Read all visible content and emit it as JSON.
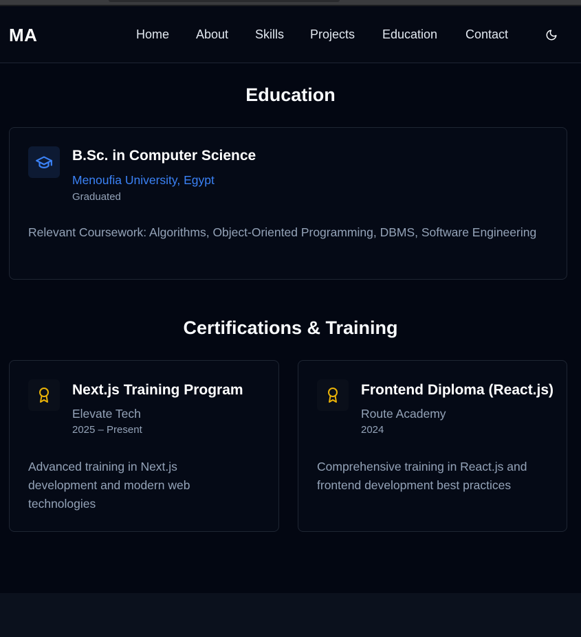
{
  "nav": {
    "logo": "MA",
    "links": [
      "Home",
      "About",
      "Skills",
      "Projects",
      "Education",
      "Contact"
    ],
    "theme_icon": "moon-icon"
  },
  "education": {
    "title": "Education",
    "card": {
      "icon": "graduation-cap-icon",
      "degree": "B.Sc. in Computer Science",
      "university": "Menoufia University, Egypt",
      "status": "Graduated",
      "coursework": "Relevant Coursework: Algorithms, Object-Oriented Programming, DBMS, Software Engineering"
    }
  },
  "certifications": {
    "title": "Certifications & Training",
    "items": [
      {
        "icon": "award-icon",
        "title": "Next.js Training Program",
        "org": "Elevate Tech",
        "date": "2025 – Present",
        "desc": "Advanced training in Next.js development and modern web technologies"
      },
      {
        "icon": "award-icon",
        "title": "Frontend Diploma (React.js)",
        "org": "Route Academy",
        "date": "2024",
        "desc": "Comprehensive training in React.js and frontend development best practices"
      }
    ]
  },
  "colors": {
    "background": "#030712",
    "accent_blue": "#3b82f6",
    "award_gold": "#eab308",
    "muted_text": "#94a3b8"
  }
}
